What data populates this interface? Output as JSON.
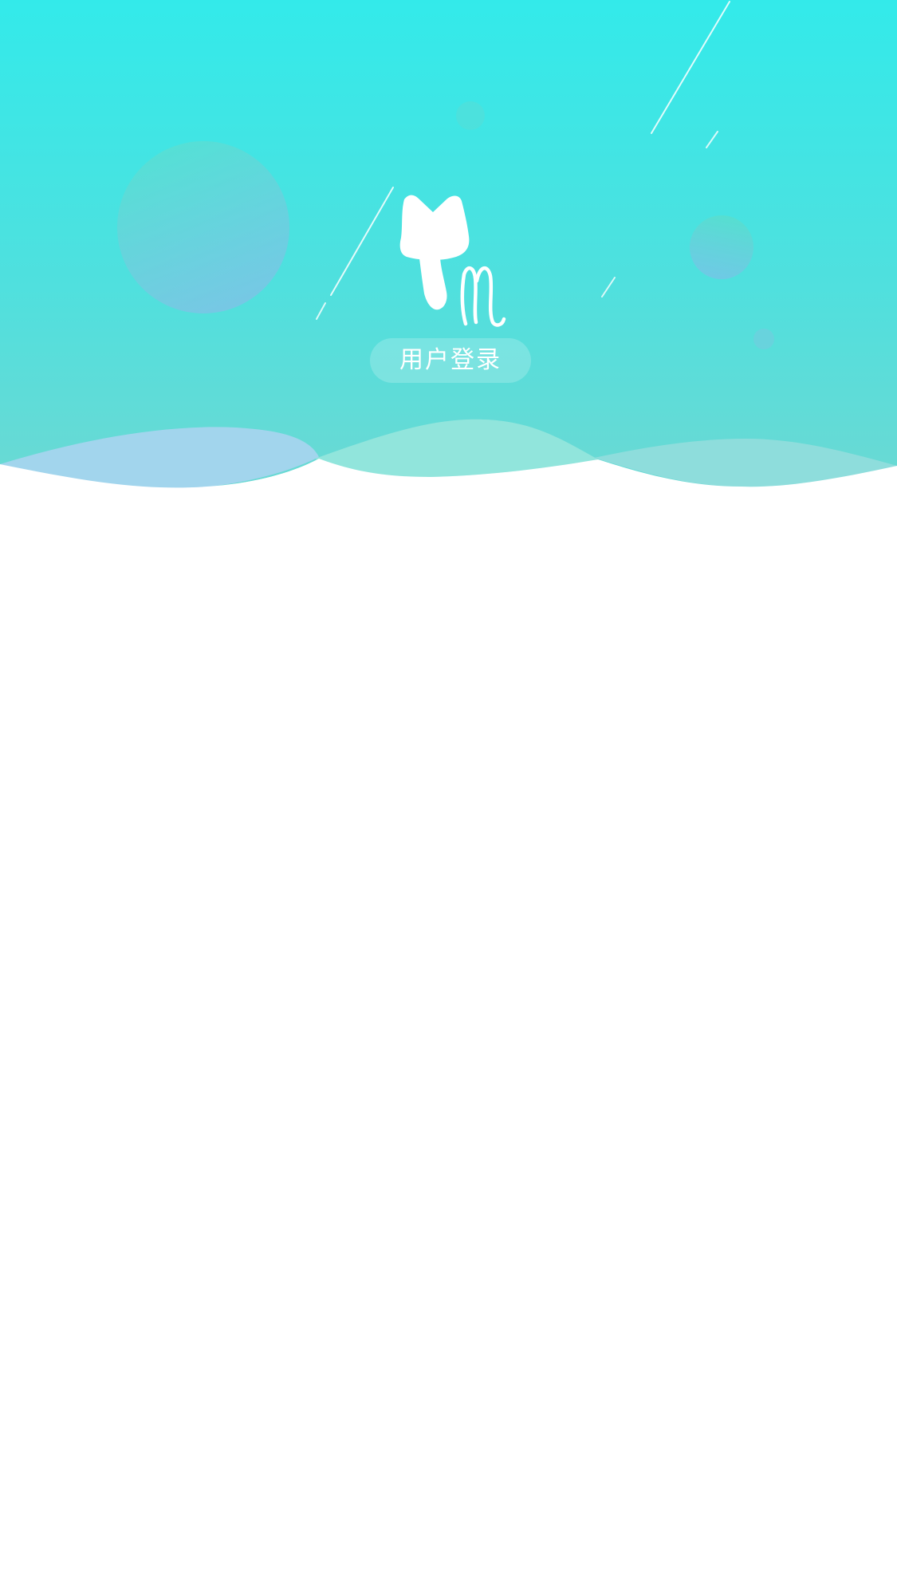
{
  "app": {
    "logo_icon": "cat-tm-logo-icon",
    "login_button_label": "用户登录"
  },
  "theme": {
    "gradient_top": "#33EAEA",
    "gradient_bottom": "#6ED8D2",
    "wave_left": "#A5D5EE",
    "wave_middle": "#94E6DC",
    "wave_right": "#90DDDC",
    "text_on_hero": "#FFFFFF",
    "page_background": "#FFFFFF"
  }
}
